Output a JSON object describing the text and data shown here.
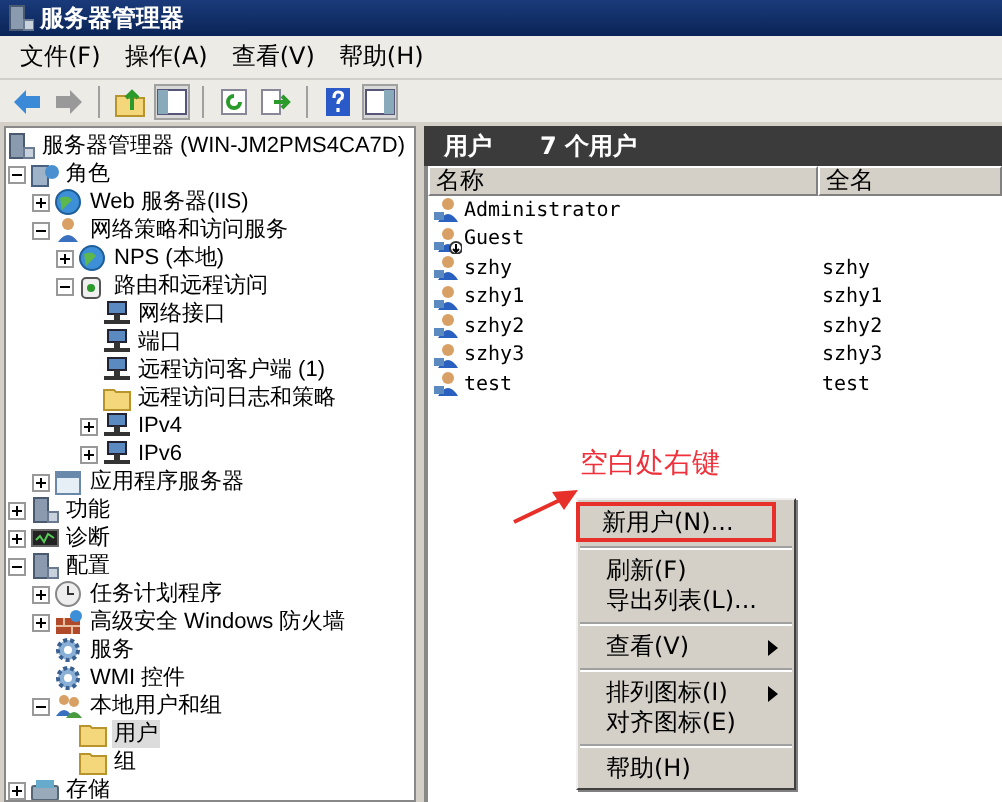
{
  "window": {
    "title": "服务器管理器"
  },
  "menu_bar": [
    "文件(F)",
    "操作(A)",
    "查看(V)",
    "帮助(H)"
  ],
  "toolbar": [
    [
      {
        "pressed": false
      },
      {
        "pressed": false
      }
    ],
    [
      {
        "pressed": false
      },
      {
        "pressed": true
      }
    ],
    [
      {
        "pressed": false
      },
      {
        "pressed": false
      }
    ],
    [
      {
        "pressed": false
      },
      {
        "pressed": true
      }
    ]
  ],
  "tree": [
    {
      "label": "服务器管理器 (WIN-JM2PMS4CA7D)",
      "kind": "root",
      "selected": false,
      "children": [
        {
          "label": "角色",
          "kind": "branch",
          "expanded": true,
          "selected": false,
          "children": [
            {
              "label": "Web 服务器(IIS)",
              "kind": "branch",
              "expanded": false,
              "selected": false
            },
            {
              "label": "网络策略和访问服务",
              "kind": "branch",
              "expanded": true,
              "selected": false,
              "children": [
                {
                  "label": "NPS (本地)",
                  "kind": "branch",
                  "expanded": false,
                  "selected": false
                },
                {
                  "label": "路由和远程访问",
                  "kind": "branch",
                  "expanded": true,
                  "selected": false,
                  "children": [
                    {
                      "label": "网络接口",
                      "kind": "leaf",
                      "selected": false
                    },
                    {
                      "label": "端口",
                      "kind": "leaf",
                      "selected": false
                    },
                    {
                      "label": "远程访问客户端 (1)",
                      "kind": "leaf",
                      "selected": false
                    },
                    {
                      "label": "远程访问日志和策略",
                      "kind": "leaf",
                      "selected": false
                    },
                    {
                      "label": "IPv4",
                      "kind": "branch",
                      "expanded": false,
                      "selected": false
                    },
                    {
                      "label": "IPv6",
                      "kind": "branch",
                      "expanded": false,
                      "selected": false
                    }
                  ]
                }
              ]
            },
            {
              "label": "应用程序服务器",
              "kind": "branch",
              "expanded": false,
              "selected": false
            }
          ]
        },
        {
          "label": "功能",
          "kind": "branch",
          "expanded": false,
          "selected": false
        },
        {
          "label": "诊断",
          "kind": "branch",
          "expanded": false,
          "selected": false
        },
        {
          "label": "配置",
          "kind": "branch",
          "expanded": true,
          "selected": false,
          "children": [
            {
              "label": "任务计划程序",
              "kind": "branch",
              "expanded": false,
              "selected": false
            },
            {
              "label": "高级安全 Windows 防火墙",
              "kind": "branch",
              "expanded": false,
              "selected": false
            },
            {
              "label": "服务",
              "kind": "leaf",
              "selected": false
            },
            {
              "label": "WMI 控件",
              "kind": "leaf",
              "selected": false
            },
            {
              "label": "本地用户和组",
              "kind": "branch",
              "expanded": true,
              "selected": false,
              "children": [
                {
                  "label": "用户",
                  "kind": "leaf",
                  "selected": true
                },
                {
                  "label": "组",
                  "kind": "leaf",
                  "selected": false
                }
              ]
            }
          ]
        },
        {
          "label": "存储",
          "kind": "branch",
          "expanded": false,
          "selected": false
        }
      ]
    }
  ],
  "pane_header": {
    "title": "用户",
    "count": "7 个用户"
  },
  "table": {
    "columns": [
      "名称",
      "全名"
    ],
    "rows": [
      {
        "name": "Administrator",
        "full_name": "",
        "disabled": false
      },
      {
        "name": "Guest",
        "full_name": "",
        "disabled": true
      },
      {
        "name": "szhy",
        "full_name": "szhy",
        "disabled": false
      },
      {
        "name": "szhy1",
        "full_name": "szhy1",
        "disabled": false
      },
      {
        "name": "szhy2",
        "full_name": "szhy2",
        "disabled": false
      },
      {
        "name": "szhy3",
        "full_name": "szhy3",
        "disabled": false
      },
      {
        "name": "test",
        "full_name": "test",
        "disabled": false
      }
    ]
  },
  "annotation": {
    "text": "空白处右键"
  },
  "context_menu": [
    [
      {
        "label": "新用户(N)...",
        "submenu": false,
        "marked": true
      }
    ],
    [
      {
        "label": "刷新(F)",
        "submenu": false,
        "marked": false
      },
      {
        "label": "导出列表(L)...",
        "submenu": false,
        "marked": false
      }
    ],
    [
      {
        "label": "查看(V)",
        "submenu": true,
        "marked": false
      }
    ],
    [
      {
        "label": "排列图标(I)",
        "submenu": true,
        "marked": false
      },
      {
        "label": "对齐图标(E)",
        "submenu": false,
        "marked": false
      }
    ],
    [
      {
        "label": "帮助(H)",
        "submenu": false,
        "marked": false
      }
    ]
  ]
}
